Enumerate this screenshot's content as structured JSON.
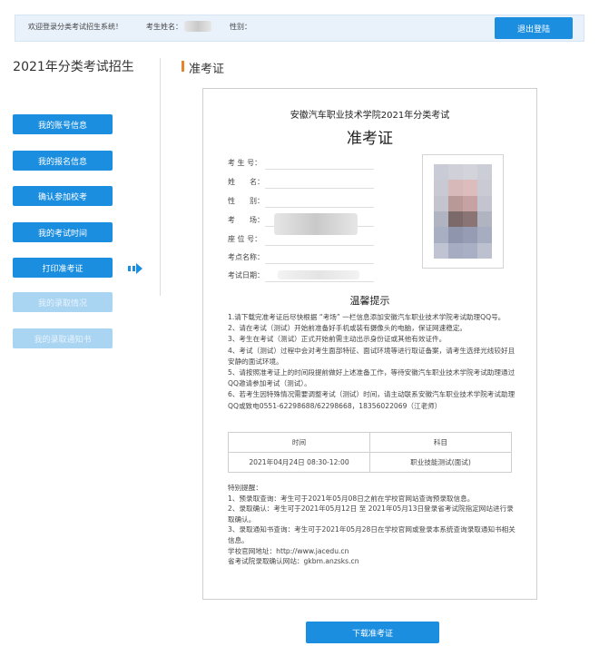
{
  "topbar": {
    "welcome": "欢迎登录分类考试招生系统！",
    "name_label": "考生姓名：",
    "gender_label": "性别：",
    "logout_label": "退出登陆"
  },
  "sidebar": {
    "title": "2021年分类考试招生",
    "items": [
      {
        "label": "我的账号信息",
        "enabled": true
      },
      {
        "label": "我的报名信息",
        "enabled": true
      },
      {
        "label": "确认参加校考",
        "enabled": true
      },
      {
        "label": "我的考试时间",
        "enabled": true
      },
      {
        "label": "打印准考证",
        "enabled": true,
        "active": true
      },
      {
        "label": "我的录取情况",
        "enabled": false
      },
      {
        "label": "我的录取通知书",
        "enabled": false
      }
    ]
  },
  "section": {
    "title": "准考证"
  },
  "ticket": {
    "school_title": "安徽汽车职业技术学院2021年分类考试",
    "doc_title": "准考证",
    "fields": [
      {
        "label": "考 生 号："
      },
      {
        "label": "姓　　名："
      },
      {
        "label": "性　　别："
      },
      {
        "label": "考　　场："
      },
      {
        "label": "座 位 号："
      },
      {
        "label": "考点名称："
      },
      {
        "label": "考试日期："
      }
    ],
    "tips_title": "温馨提示",
    "tips": [
      "1.请下载完准考证后尽快根据 “考场” 一栏信息添加安徽汽车职业技术学院考试助理QQ号。",
      "2、请在考试（测试）开始前准备好手机或装有摄像头的电脑，保证网速稳定。",
      "3、考生在考试（测试）正式开始前需主动出示身份证或其他有效证件。",
      "4、考试（测试）过程中会对考生面部特征、面试环境等进行取证备案，请考生选择光线较好且安静的面试环境。",
      "5、请按照准考证上的时间段提前做好上述准备工作，等待安徽汽车职业技术学院考试助理通过QQ邀请参加考试（测试）。",
      "6、若考生因特殊情况需要调整考试（测试）时间，请主动联系安徽汽车职业技术学院考试助理QQ或致电0551-62298688/62298668，18356022069（江老师）"
    ],
    "schedule": {
      "headers": [
        "时间",
        "科目"
      ],
      "rows": [
        [
          "2021年04月24日 08:30-12:00",
          "职业技能测试(面试)"
        ]
      ]
    },
    "notes": [
      "特别提醒：",
      "1、预录取查询：考生可于2021年05月08日之前在学校官网站查询预录取信息。",
      "2、录取确认：考生可于2021年05月12日 至 2021年05月13日登录省考试院指定网站进行录取确认。",
      "3、录取通知书查询：考生可于2021年05月28日在学校官网或登录本系统查询录取通知书相关信息。",
      "学校官网地址：http://www.jacedu.cn",
      "省考试院录取确认网站：gkbm.anzsks.cn"
    ]
  },
  "download_label": "下载准考证",
  "colors": {
    "accent": "#1b8ee0",
    "accent_disabled": "#a9d4f2",
    "section_marker": "#e8832a"
  }
}
